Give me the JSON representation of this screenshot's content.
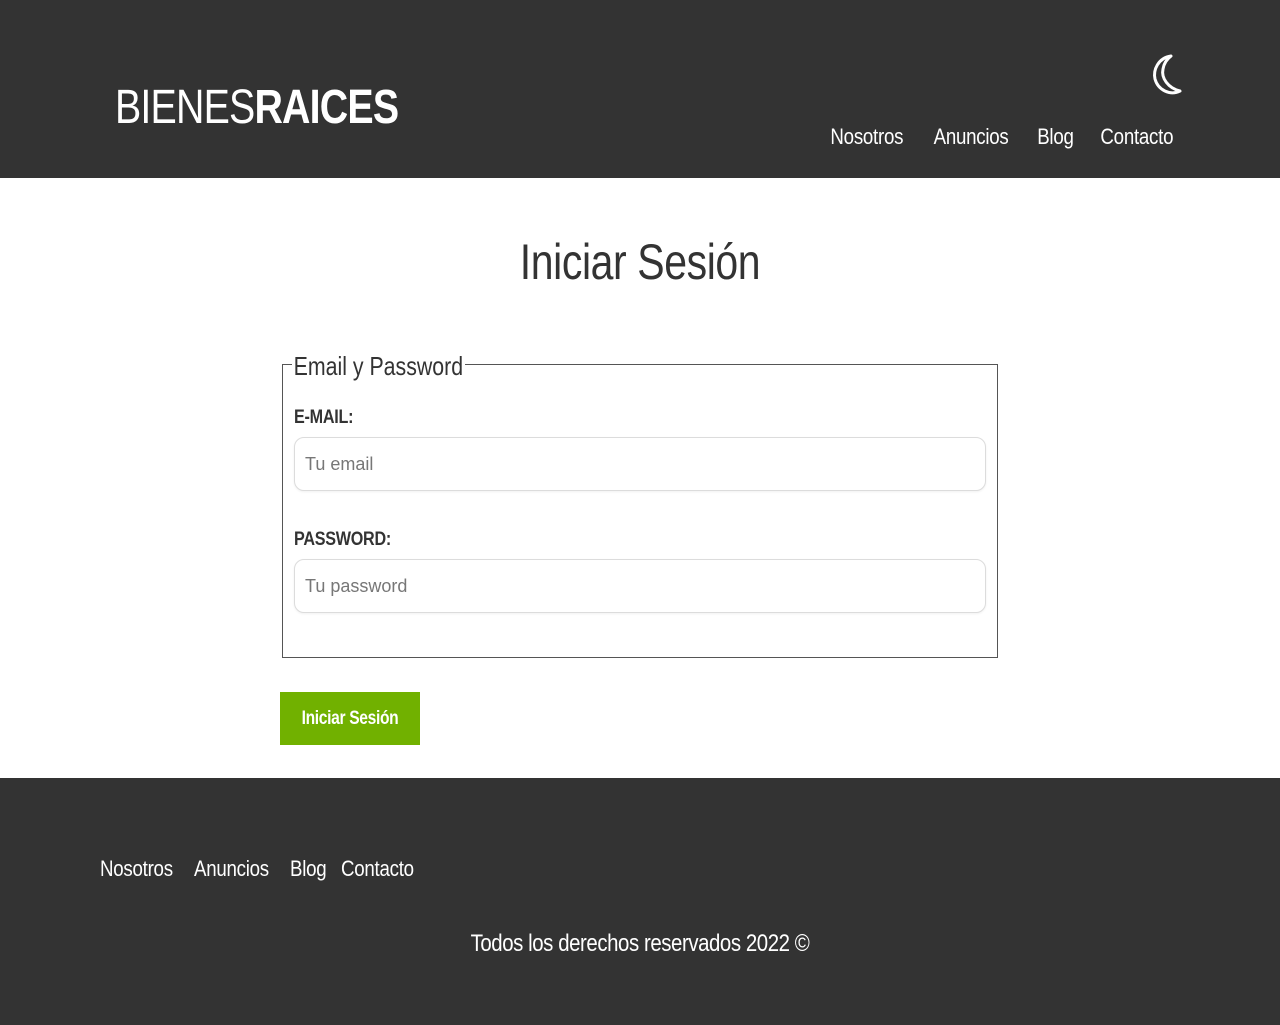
{
  "header": {
    "logo": {
      "light": "BIENES",
      "bold": "RAICES"
    },
    "theme_toggle_icon": "moon-icon",
    "nav": [
      "Nosotros",
      "Anuncios",
      "Blog",
      "Contacto"
    ]
  },
  "main": {
    "title": "Iniciar Sesión",
    "fieldset": {
      "legend": "Email y Password",
      "email_label": "E-MAIL:",
      "email_placeholder": "Tu email",
      "email_value": "",
      "password_label": "PASSWORD:",
      "password_placeholder": "Tu password",
      "password_value": ""
    },
    "submit_label": "Iniciar Sesión"
  },
  "footer": {
    "nav": [
      "Nosotros",
      "Anuncios",
      "Blog",
      "Contacto"
    ],
    "copyright": "Todos los derechos reservados 2022 ©"
  },
  "colors": {
    "header_bg": "#333333",
    "footer_bg": "#333333",
    "accent": "#71b100"
  }
}
